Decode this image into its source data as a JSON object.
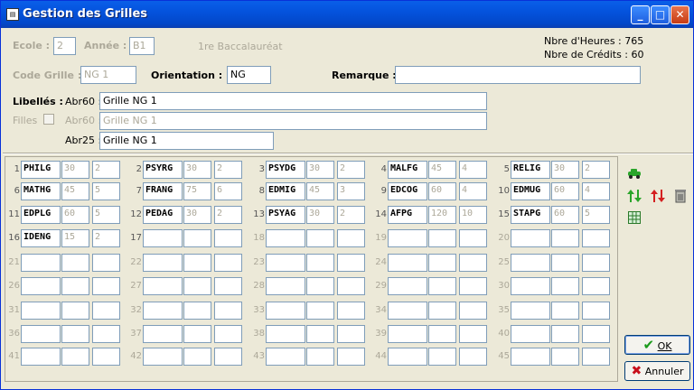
{
  "window": {
    "title": "Gestion des Grilles",
    "icon_label": "▤"
  },
  "header": {
    "ecole_label": "Ecole :",
    "ecole_value": "2",
    "annee_label": "Année :",
    "annee_value": "B1",
    "level_text": "1re Baccalauréat",
    "hours_text": "Nbre d'Heures : 765",
    "credits_text": "Nbre de Crédits : 60",
    "code_grille_label": "Code Grille :",
    "code_grille_value": "NG 1",
    "orientation_label": "Orientation :",
    "orientation_value": "NG",
    "remarque_label": "Remarque :",
    "remarque_value": "",
    "libelles_label": "Libellés :",
    "filles_label": "Filles",
    "abr60_label": "Abr60 :",
    "abr60_value": "Grille NG 1",
    "abr60_filles_label": "Abr60 :",
    "abr60_filles_value": "Grille NG 1",
    "abr25_label": "Abr25 :",
    "abr25_value": "Grille NG 1"
  },
  "grid": {
    "slots": [
      {
        "n": "1",
        "code": "PHILG",
        "h": "30",
        "c": "2"
      },
      {
        "n": "2",
        "code": "PSYRG",
        "h": "30",
        "c": "2"
      },
      {
        "n": "3",
        "code": "PSYDG",
        "h": "30",
        "c": "2"
      },
      {
        "n": "4",
        "code": "MALFG",
        "h": "45",
        "c": "4"
      },
      {
        "n": "5",
        "code": "RELIG",
        "h": "30",
        "c": "2"
      },
      {
        "n": "6",
        "code": "MATHG",
        "h": "45",
        "c": "5"
      },
      {
        "n": "7",
        "code": "FRANG",
        "h": "75",
        "c": "6"
      },
      {
        "n": "8",
        "code": "EDMIG",
        "h": "45",
        "c": "3"
      },
      {
        "n": "9",
        "code": "EDCOG",
        "h": "60",
        "c": "4"
      },
      {
        "n": "10",
        "code": "EDMUG",
        "h": "60",
        "c": "4"
      },
      {
        "n": "11",
        "code": "EDPLG",
        "h": "60",
        "c": "5"
      },
      {
        "n": "12",
        "code": "PEDAG",
        "h": "30",
        "c": "2"
      },
      {
        "n": "13",
        "code": "PSYAG",
        "h": "30",
        "c": "2"
      },
      {
        "n": "14",
        "code": "AFPG",
        "h": "120",
        "c": "10"
      },
      {
        "n": "15",
        "code": "STAPG",
        "h": "60",
        "c": "5"
      },
      {
        "n": "16",
        "code": "IDENG",
        "h": "15",
        "c": "2"
      },
      {
        "n": "17",
        "code": "",
        "h": "",
        "c": ""
      },
      {
        "n": "18",
        "code": "",
        "h": "",
        "c": ""
      },
      {
        "n": "19",
        "code": "",
        "h": "",
        "c": ""
      },
      {
        "n": "20",
        "code": "",
        "h": "",
        "c": ""
      },
      {
        "n": "21",
        "code": "",
        "h": "",
        "c": ""
      },
      {
        "n": "22",
        "code": "",
        "h": "",
        "c": ""
      },
      {
        "n": "23",
        "code": "",
        "h": "",
        "c": ""
      },
      {
        "n": "24",
        "code": "",
        "h": "",
        "c": ""
      },
      {
        "n": "25",
        "code": "",
        "h": "",
        "c": ""
      },
      {
        "n": "26",
        "code": "",
        "h": "",
        "c": ""
      },
      {
        "n": "27",
        "code": "",
        "h": "",
        "c": ""
      },
      {
        "n": "28",
        "code": "",
        "h": "",
        "c": ""
      },
      {
        "n": "29",
        "code": "",
        "h": "",
        "c": ""
      },
      {
        "n": "30",
        "code": "",
        "h": "",
        "c": ""
      },
      {
        "n": "31",
        "code": "",
        "h": "",
        "c": ""
      },
      {
        "n": "32",
        "code": "",
        "h": "",
        "c": ""
      },
      {
        "n": "33",
        "code": "",
        "h": "",
        "c": ""
      },
      {
        "n": "34",
        "code": "",
        "h": "",
        "c": ""
      },
      {
        "n": "35",
        "code": "",
        "h": "",
        "c": ""
      },
      {
        "n": "36",
        "code": "",
        "h": "",
        "c": ""
      },
      {
        "n": "37",
        "code": "",
        "h": "",
        "c": ""
      },
      {
        "n": "38",
        "code": "",
        "h": "",
        "c": ""
      },
      {
        "n": "39",
        "code": "",
        "h": "",
        "c": ""
      },
      {
        "n": "40",
        "code": "",
        "h": "",
        "c": ""
      },
      {
        "n": "41",
        "code": "",
        "h": "",
        "c": ""
      },
      {
        "n": "42",
        "code": "",
        "h": "",
        "c": ""
      },
      {
        "n": "43",
        "code": "",
        "h": "",
        "c": ""
      },
      {
        "n": "44",
        "code": "",
        "h": "",
        "c": ""
      },
      {
        "n": "45",
        "code": "",
        "h": "",
        "c": ""
      }
    ]
  },
  "buttons": {
    "ok_label": "OK",
    "cancel_label": "Annuler"
  },
  "colors": {
    "title_bar": "#0453dd",
    "ok_check": "#1a9a1a",
    "cancel_x": "#c8101c",
    "arrow_up_green": "#2aa52a",
    "arrow_red": "#d42020"
  }
}
